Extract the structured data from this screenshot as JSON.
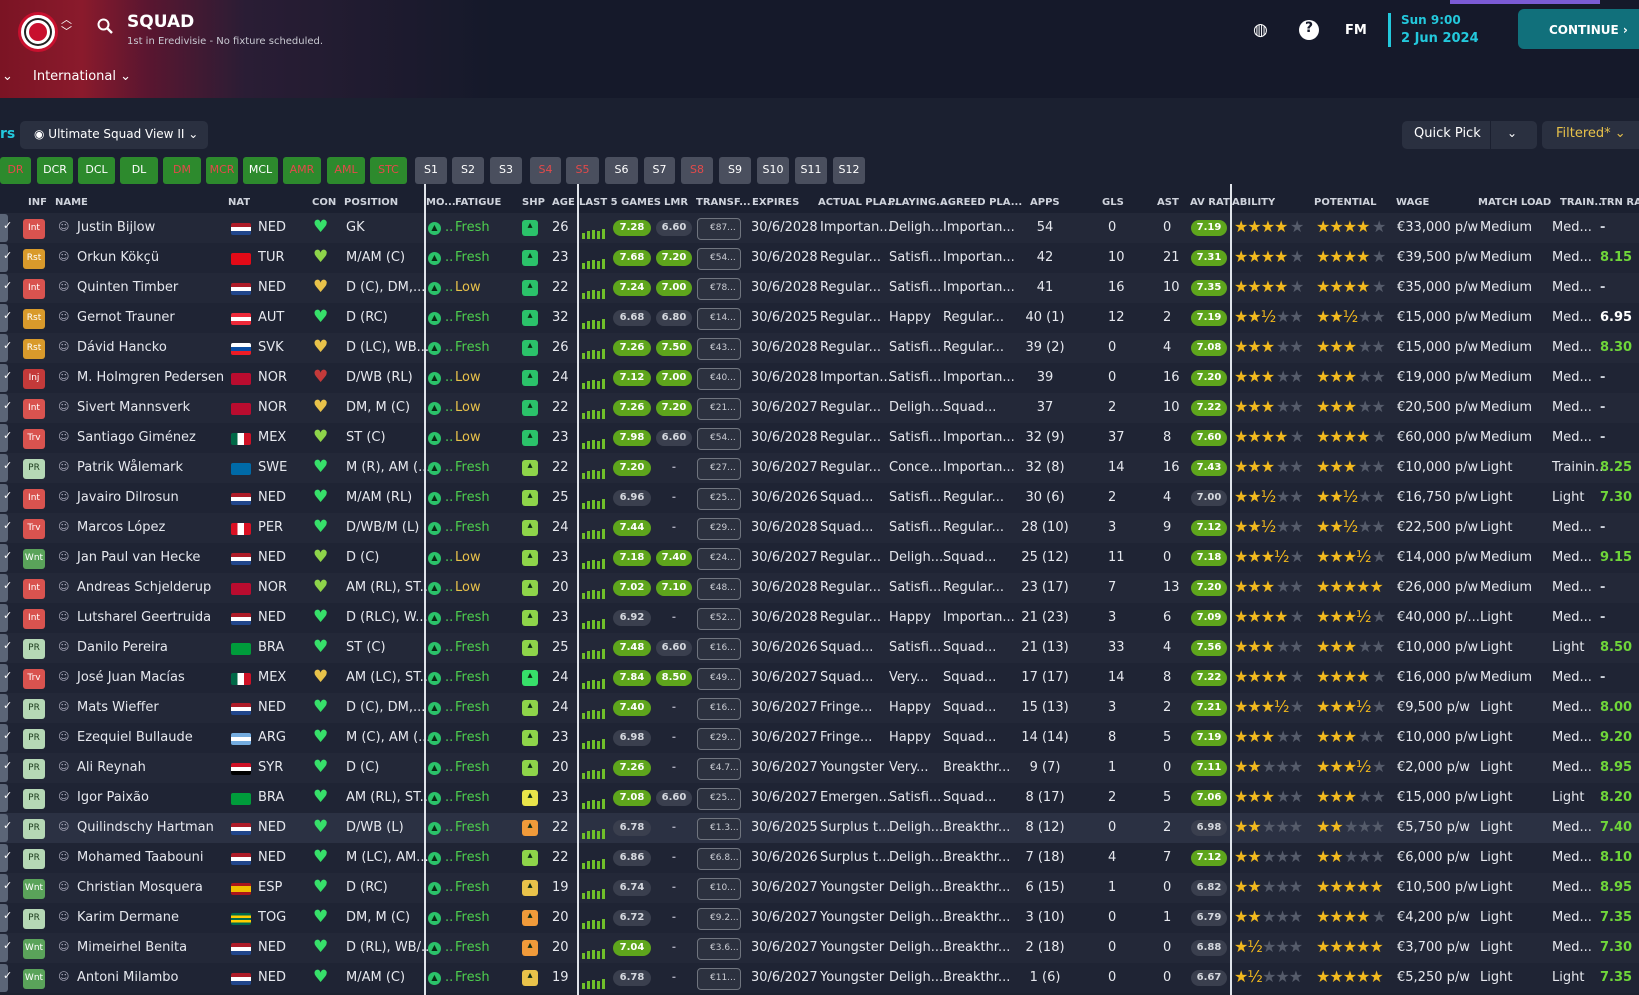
{
  "header": {
    "title": "SQUAD",
    "subtitle": "1st in Eredivisie - No fixture scheduled.",
    "nav": "International",
    "time": "Sun 9:00",
    "date": "2 Jun 2024",
    "continue": "CONTINUE",
    "fm": "FM"
  },
  "toolbar": {
    "view": "Ultimate Squad View II",
    "quick_pick": "Quick Pick",
    "filtered": "Filtered*",
    "left_label": "rs"
  },
  "positions": [
    {
      "l": "DR",
      "c": "#2d8a2d",
      "t": "#e34a4a"
    },
    {
      "l": "DCR",
      "c": "#2d8a2d",
      "t": "#fff"
    },
    {
      "l": "DCL",
      "c": "#2d8a2d",
      "t": "#fff"
    },
    {
      "l": "DL",
      "c": "#2d8a2d",
      "t": "#fff"
    },
    {
      "l": "DM",
      "c": "#2d8a2d",
      "t": "#e34a4a"
    },
    {
      "l": "MCR",
      "c": "#2d8a2d",
      "t": "#e34a4a"
    },
    {
      "l": "MCL",
      "c": "#2d8a2d",
      "t": "#fff"
    },
    {
      "l": "AMR",
      "c": "#2d8a2d",
      "t": "#e34a4a"
    },
    {
      "l": "AML",
      "c": "#2d8a2d",
      "t": "#e34a4a"
    },
    {
      "l": "STC",
      "c": "#2d8a2d",
      "t": "#e34a4a"
    },
    {
      "l": "S1",
      "c": "#4a4f5e",
      "t": "#fff"
    },
    {
      "l": "S2",
      "c": "#4a4f5e",
      "t": "#fff"
    },
    {
      "l": "S3",
      "c": "#4a4f5e",
      "t": "#fff"
    },
    {
      "l": "S4",
      "c": "#4a4f5e",
      "t": "#e34a4a"
    },
    {
      "l": "S5",
      "c": "#4a4f5e",
      "t": "#e34a4a"
    },
    {
      "l": "S6",
      "c": "#4a4f5e",
      "t": "#fff"
    },
    {
      "l": "S7",
      "c": "#4a4f5e",
      "t": "#fff"
    },
    {
      "l": "S8",
      "c": "#4a4f5e",
      "t": "#e34a4a"
    },
    {
      "l": "S9",
      "c": "#4a4f5e",
      "t": "#fff"
    },
    {
      "l": "S10",
      "c": "#4a4f5e",
      "t": "#fff"
    },
    {
      "l": "S11",
      "c": "#4a4f5e",
      "t": "#fff"
    },
    {
      "l": "S12",
      "c": "#4a4f5e",
      "t": "#fff"
    }
  ],
  "columns": [
    "INF",
    "NAME",
    "NAT",
    "CON",
    "POSITION",
    "MO...",
    "FATIGUE",
    "SHP",
    "AGE",
    "LAST 5 GAMES",
    "LMR",
    "TRANSF...",
    "EXPIRES",
    "ACTUAL PLA...",
    "PLAYING...",
    "AGREED PLA...",
    "APPS",
    "GLS",
    "AST",
    "AV RAT",
    "ABILITY",
    "POTENTIAL",
    "WAGE",
    "MATCH LOAD",
    "TRAIN...",
    "TRN RAT"
  ],
  "players": [
    {
      "inf": "Int",
      "ic": "#d9534f",
      "name": "Justin Bijlow",
      "nat": "NED",
      "f": "ned",
      "con": "#37e06a",
      "pos": "GK",
      "fat": "Fresh",
      "shp": "#2bc26a",
      "age": "26",
      "l5": "7.28",
      "lmr": "6.60",
      "tf": "€87...",
      "exp": "30/6/2028",
      "act": "Importan...",
      "play": "Deligh...",
      "agr": "Importan...",
      "apps": "54",
      "gls": "0",
      "ast": "0",
      "avr": "7.19",
      "ab": "★★★★",
      "abe": "★",
      "pot": "★★★★",
      "pote": "★",
      "wage": "€33,000 p/w",
      "load": "Medium",
      "tr": "Med...",
      "trn": "-"
    },
    {
      "inf": "Rst",
      "ic": "#d99a2b",
      "name": "Orkun Kökçü",
      "nat": "TUR",
      "f": "tur",
      "con": "#8ed44a",
      "pos": "M/AM (C)",
      "fat": "Fresh",
      "shp": "#2bc26a",
      "age": "23",
      "l5": "7.68",
      "lmr": "7.20",
      "tf": "€54...",
      "exp": "30/6/2028",
      "act": "Regular...",
      "play": "Satisfi...",
      "agr": "Importan...",
      "apps": "42",
      "gls": "10",
      "ast": "21",
      "avr": "7.31",
      "ab": "★★★★",
      "abe": "★",
      "pot": "★★★★",
      "pote": "★",
      "wage": "€39,500 p/w",
      "load": "Medium",
      "tr": "Med...",
      "trn": "8.15"
    },
    {
      "inf": "Int",
      "ic": "#d9534f",
      "name": "Quinten Timber",
      "nat": "NED",
      "f": "ned",
      "con": "#e8c24a",
      "pos": "D (C), DM,...",
      "fat": "Low",
      "shp": "#2bc26a",
      "age": "22",
      "l5": "7.24",
      "lmr": "7.00",
      "tf": "€78...",
      "exp": "30/6/2028",
      "act": "Regular...",
      "play": "Satisfi...",
      "agr": "Importan...",
      "apps": "41",
      "gls": "16",
      "ast": "10",
      "avr": "7.35",
      "ab": "★★★★",
      "abe": "★",
      "pot": "★★★★",
      "pote": "★",
      "wage": "€35,000 p/w",
      "load": "Medium",
      "tr": "Med...",
      "trn": "-"
    },
    {
      "inf": "Rst",
      "ic": "#d99a2b",
      "name": "Gernot Trauner",
      "nat": "AUT",
      "f": "aut",
      "con": "#37e06a",
      "pos": "D (RC)",
      "fat": "Fresh",
      "shp": "#2bc26a",
      "age": "32",
      "l5": "6.68",
      "lmr": "6.80",
      "tf": "€14...",
      "exp": "30/6/2025",
      "act": "Regular...",
      "play": "Happy",
      "agr": "Regular...",
      "apps": "40 (1)",
      "gls": "12",
      "ast": "2",
      "avr": "7.19",
      "ab": "★★½",
      "abe": "★★",
      "pot": "★★½",
      "pote": "★★",
      "wage": "€15,000 p/w",
      "load": "Medium",
      "tr": "Med...",
      "trn": "6.95"
    },
    {
      "inf": "Rst",
      "ic": "#d99a2b",
      "name": "Dávid Hancko",
      "nat": "SVK",
      "f": "svk",
      "con": "#e8c24a",
      "pos": "D (LC), WB...",
      "fat": "Fresh",
      "shp": "#2bc26a",
      "age": "26",
      "l5": "7.26",
      "lmr": "7.50",
      "tf": "€43...",
      "exp": "30/6/2028",
      "act": "Regular...",
      "play": "Satisfi...",
      "agr": "Regular...",
      "apps": "39 (2)",
      "gls": "0",
      "ast": "4",
      "avr": "7.08",
      "ab": "★★★",
      "abe": "★★",
      "pot": "★★★",
      "pote": "★★",
      "wage": "€15,000 p/w",
      "load": "Medium",
      "tr": "Med...",
      "trn": "8.30"
    },
    {
      "inf": "Inj",
      "ic": "#c43a3a",
      "name": "M. Holmgren Pedersen",
      "nat": "NOR",
      "f": "nor",
      "con": "#c43a3a",
      "pos": "D/WB (RL)",
      "fat": "Low",
      "shp": "#2bc26a",
      "age": "24",
      "l5": "7.12",
      "lmr": "7.00",
      "tf": "€40...",
      "exp": "30/6/2028",
      "act": "Importan...",
      "play": "Satisfi...",
      "agr": "Importan...",
      "apps": "39",
      "gls": "0",
      "ast": "16",
      "avr": "7.20",
      "ab": "★★★",
      "abe": "★★",
      "pot": "★★★",
      "pote": "★★",
      "wage": "€19,000 p/w",
      "load": "Medium",
      "tr": "Med...",
      "trn": "-"
    },
    {
      "inf": "Int",
      "ic": "#d9534f",
      "name": "Sivert Mannsverk",
      "nat": "NOR",
      "f": "nor",
      "con": "#e8c24a",
      "pos": "DM, M (C)",
      "fat": "Low",
      "shp": "#2bc26a",
      "age": "22",
      "l5": "7.26",
      "lmr": "7.20",
      "tf": "€21...",
      "exp": "30/6/2027",
      "act": "Regular...",
      "play": "Deligh...",
      "agr": "Squad...",
      "apps": "37",
      "gls": "2",
      "ast": "10",
      "avr": "7.22",
      "ab": "★★★",
      "abe": "★★",
      "pot": "★★★",
      "pote": "★★",
      "wage": "€20,500 p/w",
      "load": "Medium",
      "tr": "Med...",
      "trn": "-"
    },
    {
      "inf": "Trv",
      "ic": "#d9534f",
      "name": "Santiago Giménez",
      "nat": "MEX",
      "f": "mex",
      "con": "#8ed44a",
      "pos": "ST (C)",
      "fat": "Low",
      "shp": "#2bc26a",
      "age": "23",
      "l5": "7.98",
      "lmr": "6.60",
      "tf": "€54...",
      "exp": "30/6/2028",
      "act": "Regular...",
      "play": "Satisfi...",
      "agr": "Importan...",
      "apps": "32 (9)",
      "gls": "37",
      "ast": "8",
      "avr": "7.60",
      "ab": "★★★★",
      "abe": "★",
      "pot": "★★★★",
      "pote": "★",
      "wage": "€60,000 p/w",
      "load": "Medium",
      "tr": "Med...",
      "trn": "-"
    },
    {
      "inf": "PR",
      "ic": "#b5d8b5",
      "name": "Patrik Wålemark",
      "nat": "SWE",
      "f": "swe",
      "con": "#37e06a",
      "pos": "M (R), AM (...",
      "fat": "Fresh",
      "shp": "#8ed44a",
      "age": "22",
      "l5": "7.20",
      "lmr": "-",
      "tf": "€27...",
      "exp": "30/6/2027",
      "act": "Regular...",
      "play": "Conce...",
      "agr": "Importan...",
      "apps": "32 (8)",
      "gls": "14",
      "ast": "16",
      "avr": "7.43",
      "ab": "★★★",
      "abe": "★★",
      "pot": "★★★",
      "pote": "★★",
      "wage": "€10,000 p/w",
      "load": "Light",
      "tr": "Trainin...",
      "trn": "8.25"
    },
    {
      "inf": "Int",
      "ic": "#d9534f",
      "name": "Javairo Dilrosun",
      "nat": "NED",
      "f": "ned",
      "con": "#37e06a",
      "pos": "M/AM (RL)",
      "fat": "Fresh",
      "shp": "#8ed44a",
      "age": "25",
      "l5": "6.96",
      "lmr": "-",
      "tf": "€25...",
      "exp": "30/6/2026",
      "act": "Squad...",
      "play": "Satisfi...",
      "agr": "Regular...",
      "apps": "30 (6)",
      "gls": "2",
      "ast": "4",
      "avr": "7.00",
      "ab": "★★½",
      "abe": "★★",
      "pot": "★★½",
      "pote": "★★",
      "wage": "€16,750 p/w",
      "load": "Light",
      "tr": "Light",
      "trn": "7.30"
    },
    {
      "inf": "Trv",
      "ic": "#d9534f",
      "name": "Marcos López",
      "nat": "PER",
      "f": "per",
      "con": "#37e06a",
      "pos": "D/WB/M (L)",
      "fat": "Fresh",
      "shp": "#8ed44a",
      "age": "24",
      "l5": "7.44",
      "lmr": "-",
      "tf": "€29...",
      "exp": "30/6/2028",
      "act": "Squad...",
      "play": "Satisfi...",
      "agr": "Regular...",
      "apps": "28 (10)",
      "gls": "3",
      "ast": "9",
      "avr": "7.12",
      "ab": "★★½",
      "abe": "★★",
      "pot": "★★½",
      "pote": "★★",
      "wage": "€22,500 p/w",
      "load": "Light",
      "tr": "Med...",
      "trn": "-"
    },
    {
      "inf": "Wnt",
      "ic": "#5aa35a",
      "name": "Jan Paul van Hecke",
      "nat": "NED",
      "f": "ned",
      "con": "#8ed44a",
      "pos": "D (C)",
      "fat": "Low",
      "shp": "#8ed44a",
      "age": "23",
      "l5": "7.18",
      "lmr": "7.40",
      "tf": "€24...",
      "exp": "30/6/2027",
      "act": "Regular...",
      "play": "Deligh...",
      "agr": "Squad...",
      "apps": "25 (12)",
      "gls": "11",
      "ast": "0",
      "avr": "7.18",
      "ab": "★★★½",
      "abe": "★",
      "pot": "★★★½",
      "pote": "★",
      "wage": "€14,000 p/w",
      "load": "Medium",
      "tr": "Med...",
      "trn": "9.15"
    },
    {
      "inf": "Int",
      "ic": "#d9534f",
      "name": "Andreas Schjelderup",
      "nat": "NOR",
      "f": "nor",
      "con": "#8ed44a",
      "pos": "AM (RL), ST...",
      "fat": "Low",
      "shp": "#8ed44a",
      "age": "20",
      "l5": "7.02",
      "lmr": "7.10",
      "tf": "€48...",
      "exp": "30/6/2028",
      "act": "Regular...",
      "play": "Satisfi...",
      "agr": "Regular...",
      "apps": "23 (17)",
      "gls": "7",
      "ast": "13",
      "avr": "7.20",
      "ab": "★★★",
      "abe": "★★",
      "pot": "★★★★★",
      "pote": "",
      "wage": "€26,000 p/w",
      "load": "Medium",
      "tr": "Med...",
      "trn": "-"
    },
    {
      "inf": "Int",
      "ic": "#d9534f",
      "name": "Lutsharel Geertruida",
      "nat": "NED",
      "f": "ned",
      "con": "#37e06a",
      "pos": "D (RLC), W...",
      "fat": "Fresh",
      "shp": "#8ed44a",
      "age": "23",
      "l5": "6.92",
      "lmr": "-",
      "tf": "€52...",
      "exp": "30/6/2028",
      "act": "Regular...",
      "play": "Happy",
      "agr": "Importan...",
      "apps": "21 (23)",
      "gls": "3",
      "ast": "6",
      "avr": "7.09",
      "ab": "★★★★",
      "abe": "★",
      "pot": "★★★½",
      "pote": "★",
      "wage": "€40,000 p/...",
      "load": "Light",
      "tr": "Med...",
      "trn": "-"
    },
    {
      "inf": "PR",
      "ic": "#b5d8b5",
      "name": "Danilo Pereira",
      "nat": "BRA",
      "f": "bra",
      "con": "#37e06a",
      "pos": "ST (C)",
      "fat": "Fresh",
      "shp": "#8ed44a",
      "age": "25",
      "l5": "7.48",
      "lmr": "6.60",
      "tf": "€16...",
      "exp": "30/6/2026",
      "act": "Squad...",
      "play": "Satisfi...",
      "agr": "Squad...",
      "apps": "21 (13)",
      "gls": "33",
      "ast": "4",
      "avr": "7.56",
      "ab": "★★★",
      "abe": "★★",
      "pot": "★★★",
      "pote": "★★",
      "wage": "€10,000 p/w",
      "load": "Light",
      "tr": "Light",
      "trn": "8.50"
    },
    {
      "inf": "Trv",
      "ic": "#d9534f",
      "name": "José Juan Macías",
      "nat": "MEX",
      "f": "mex",
      "con": "#e8c24a",
      "pos": "AM (LC), ST...",
      "fat": "Fresh",
      "shp": "#37e06a",
      "age": "24",
      "l5": "7.84",
      "lmr": "8.50",
      "tf": "€49...",
      "exp": "30/6/2027",
      "act": "Squad...",
      "play": "Very...",
      "agr": "Squad...",
      "apps": "17 (17)",
      "gls": "14",
      "ast": "8",
      "avr": "7.22",
      "ab": "★★★★",
      "abe": "★",
      "pot": "★★★★",
      "pote": "★",
      "wage": "€16,000 p/w",
      "load": "Medium",
      "tr": "Med...",
      "trn": "-"
    },
    {
      "inf": "PR",
      "ic": "#b5d8b5",
      "name": "Mats Wieffer",
      "nat": "NED",
      "f": "ned",
      "con": "#37e06a",
      "pos": "D (C), DM,...",
      "fat": "Fresh",
      "shp": "#8ed44a",
      "age": "24",
      "l5": "7.40",
      "lmr": "-",
      "tf": "€16...",
      "exp": "30/6/2027",
      "act": "Fringe...",
      "play": "Happy",
      "agr": "Squad...",
      "apps": "15 (13)",
      "gls": "3",
      "ast": "2",
      "avr": "7.21",
      "ab": "★★★½",
      "abe": "★",
      "pot": "★★★½",
      "pote": "★",
      "wage": "€9,500 p/w",
      "load": "Light",
      "tr": "Med...",
      "trn": "8.00"
    },
    {
      "inf": "PR",
      "ic": "#b5d8b5",
      "name": "Ezequiel Bullaude",
      "nat": "ARG",
      "f": "arg",
      "con": "#37e06a",
      "pos": "M (C), AM (...",
      "fat": "Fresh",
      "shp": "#8ed44a",
      "age": "23",
      "l5": "6.98",
      "lmr": "-",
      "tf": "€29...",
      "exp": "30/6/2027",
      "act": "Fringe...",
      "play": "Happy",
      "agr": "Squad...",
      "apps": "14 (14)",
      "gls": "8",
      "ast": "5",
      "avr": "7.19",
      "ab": "★★★",
      "abe": "★★",
      "pot": "★★★",
      "pote": "★★",
      "wage": "€10,000 p/w",
      "load": "Light",
      "tr": "Med...",
      "trn": "9.20"
    },
    {
      "inf": "PR",
      "ic": "#b5d8b5",
      "name": "Ali Reynah",
      "nat": "SYR",
      "f": "syr",
      "con": "#37e06a",
      "pos": "D (C)",
      "fat": "Fresh",
      "shp": "#8ed44a",
      "age": "20",
      "l5": "7.26",
      "lmr": "-",
      "tf": "€4.7...",
      "exp": "30/6/2027",
      "act": "Youngster",
      "play": "Very...",
      "agr": "Breakthr...",
      "apps": "9 (7)",
      "gls": "1",
      "ast": "0",
      "avr": "7.11",
      "ab": "★★",
      "abe": "★★★",
      "pot": "★★★½",
      "pote": "★",
      "wage": "€2,000 p/w",
      "load": "Light",
      "tr": "Med...",
      "trn": "8.95"
    },
    {
      "inf": "PR",
      "ic": "#b5d8b5",
      "name": "Igor Paixão",
      "nat": "BRA",
      "f": "bra",
      "con": "#37e06a",
      "pos": "AM (RL), ST...",
      "fat": "Fresh",
      "shp": "#e8e44a",
      "age": "23",
      "l5": "7.08",
      "lmr": "6.60",
      "tf": "€25...",
      "exp": "30/6/2027",
      "act": "Emergen...",
      "play": "Satisfi...",
      "agr": "Squad...",
      "apps": "8 (17)",
      "gls": "2",
      "ast": "5",
      "avr": "7.06",
      "ab": "★★★",
      "abe": "★★",
      "pot": "★★★",
      "pote": "★★",
      "wage": "€15,000 p/w",
      "load": "Light",
      "tr": "Light",
      "trn": "8.20"
    },
    {
      "inf": "PR",
      "ic": "#b5d8b5",
      "name": "Quilindschy Hartman",
      "nat": "NED",
      "f": "ned",
      "con": "#37e06a",
      "pos": "D/WB (L)",
      "fat": "Fresh",
      "shp": "#f09a3a",
      "age": "22",
      "l5": "6.78",
      "lmr": "-",
      "tf": "€1.3...",
      "exp": "30/6/2025",
      "act": "Surplus t...",
      "play": "Deligh...",
      "agr": "Breakthr...",
      "apps": "8 (12)",
      "gls": "0",
      "ast": "2",
      "avr": "6.98",
      "ab": "★★",
      "abe": "★★★",
      "pot": "★★",
      "pote": "★★★",
      "wage": "€5,750 p/w",
      "load": "Light",
      "tr": "Med...",
      "trn": "7.40"
    },
    {
      "inf": "PR",
      "ic": "#b5d8b5",
      "name": "Mohamed Taabouni",
      "nat": "NED",
      "f": "ned",
      "con": "#37e06a",
      "pos": "M (LC), AM...",
      "fat": "Fresh",
      "shp": "#8ed44a",
      "age": "22",
      "l5": "6.86",
      "lmr": "-",
      "tf": "€6.8...",
      "exp": "30/6/2026",
      "act": "Surplus t...",
      "play": "Deligh...",
      "agr": "Breakthr...",
      "apps": "7 (18)",
      "gls": "4",
      "ast": "7",
      "avr": "7.12",
      "ab": "★★",
      "abe": "★★★",
      "pot": "★★",
      "pote": "★★★",
      "wage": "€6,000 p/w",
      "load": "Light",
      "tr": "Med...",
      "trn": "8.10"
    },
    {
      "inf": "Wnt",
      "ic": "#5aa35a",
      "name": "Christian Mosquera",
      "nat": "ESP",
      "f": "esp",
      "con": "#37e06a",
      "pos": "D (RC)",
      "fat": "Fresh",
      "shp": "#e8c24a",
      "age": "19",
      "l5": "6.74",
      "lmr": "-",
      "tf": "€10...",
      "exp": "30/6/2027",
      "act": "Youngster",
      "play": "Deligh...",
      "agr": "Breakthr...",
      "apps": "6 (15)",
      "gls": "1",
      "ast": "0",
      "avr": "6.82",
      "ab": "★★",
      "abe": "★★★",
      "pot": "★★★★★",
      "pote": "",
      "wage": "€10,500 p/w",
      "load": "Light",
      "tr": "Med...",
      "trn": "8.95"
    },
    {
      "inf": "PR",
      "ic": "#b5d8b5",
      "name": "Karim Dermane",
      "nat": "TOG",
      "f": "tog",
      "con": "#37e06a",
      "pos": "DM, M (C)",
      "fat": "Fresh",
      "shp": "#f09a3a",
      "age": "20",
      "l5": "6.72",
      "lmr": "-",
      "tf": "€9.2...",
      "exp": "30/6/2027",
      "act": "Youngster",
      "play": "Deligh...",
      "agr": "Breakthr...",
      "apps": "3 (10)",
      "gls": "0",
      "ast": "1",
      "avr": "6.79",
      "ab": "★★",
      "abe": "★★★",
      "pot": "★★★★",
      "pote": "★",
      "wage": "€4,200 p/w",
      "load": "Light",
      "tr": "Med...",
      "trn": "7.35"
    },
    {
      "inf": "Wnt",
      "ic": "#5aa35a",
      "name": "Mimeirhel Benita",
      "nat": "NED",
      "f": "ned",
      "con": "#37e06a",
      "pos": "D (RL), WB/...",
      "fat": "Fresh",
      "shp": "#f09a3a",
      "age": "20",
      "l5": "7.04",
      "lmr": "-",
      "tf": "€3.6...",
      "exp": "30/6/2027",
      "act": "Youngster",
      "play": "Deligh...",
      "agr": "Breakthr...",
      "apps": "2 (18)",
      "gls": "0",
      "ast": "0",
      "avr": "6.88",
      "ab": "★½",
      "abe": "★★★",
      "pot": "★★★★★",
      "pote": "",
      "wage": "€3,700 p/w",
      "load": "Light",
      "tr": "Med...",
      "trn": "7.30"
    },
    {
      "inf": "Wnt",
      "ic": "#5aa35a",
      "name": "Antoni Milambo",
      "nat": "NED",
      "f": "ned",
      "con": "#37e06a",
      "pos": "M/AM (C)",
      "fat": "Fresh",
      "shp": "#e8c24a",
      "age": "19",
      "l5": "6.78",
      "lmr": "-",
      "tf": "€11...",
      "exp": "30/6/2027",
      "act": "Youngster",
      "play": "Deligh...",
      "agr": "Breakthr...",
      "apps": "1 (6)",
      "gls": "0",
      "ast": "0",
      "avr": "6.67",
      "ab": "★½",
      "abe": "★★★",
      "pot": "★★★★★",
      "pote": "",
      "wage": "€5,250 p/w",
      "load": "Light",
      "tr": "Light",
      "trn": "7.35"
    }
  ]
}
